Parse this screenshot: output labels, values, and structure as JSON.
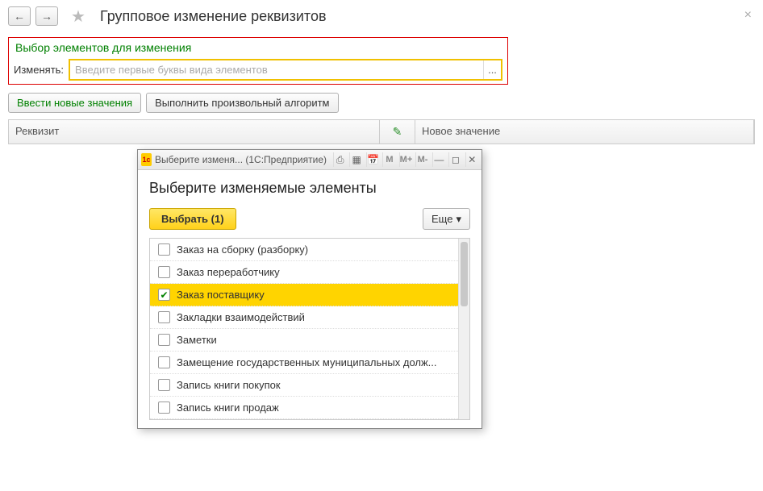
{
  "header": {
    "title": "Групповое изменение реквизитов"
  },
  "section": {
    "title": "Выбор элементов для изменения",
    "field_label": "Изменять:",
    "placeholder": "Введите первые буквы вида элементов",
    "ellipsis": "..."
  },
  "actions": {
    "enter_values": "Ввести новые значения",
    "run_algo": "Выполнить произвольный алгоритм"
  },
  "table": {
    "col_req": "Реквизит",
    "col_new": "Новое значение"
  },
  "dialog": {
    "titlebar": "Выберите изменя...   (1С:Предприятие)",
    "heading": "Выберите изменяемые элементы",
    "select_btn": "Выбрать  (1)",
    "more_btn": "Еще",
    "toolbar": {
      "m1": "M",
      "m2": "M+",
      "m3": "M-"
    },
    "items": [
      {
        "label": "Заказ на сборку (разборку)",
        "checked": false,
        "selected": false
      },
      {
        "label": "Заказ переработчику",
        "checked": false,
        "selected": false
      },
      {
        "label": "Заказ поставщику",
        "checked": true,
        "selected": true
      },
      {
        "label": "Закладки взаимодействий",
        "checked": false,
        "selected": false
      },
      {
        "label": "Заметки",
        "checked": false,
        "selected": false
      },
      {
        "label": "Замещение государственных муниципальных долж...",
        "checked": false,
        "selected": false
      },
      {
        "label": "Запись книги покупок",
        "checked": false,
        "selected": false
      },
      {
        "label": "Запись книги продаж",
        "checked": false,
        "selected": false
      }
    ]
  }
}
